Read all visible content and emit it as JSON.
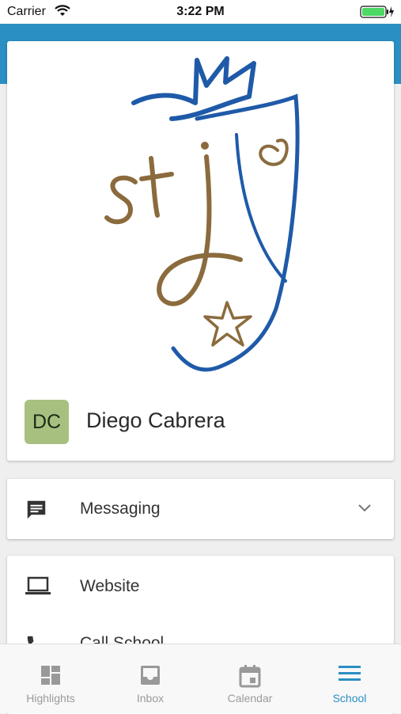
{
  "status_bar": {
    "carrier": "Carrier",
    "time": "3:22 PM"
  },
  "profile": {
    "logo_text": "stj",
    "avatar_initials": "DC",
    "name": "Diego Cabrera",
    "avatar_color": "#a7c080"
  },
  "menu": {
    "messaging_label": "Messaging",
    "website_label": "Website",
    "call_label": "Call School"
  },
  "tabs": [
    {
      "label": "Highlights",
      "icon": "dashboard-icon"
    },
    {
      "label": "Inbox",
      "icon": "inbox-icon"
    },
    {
      "label": "Calendar",
      "icon": "calendar-icon"
    },
    {
      "label": "School",
      "icon": "menu-icon"
    }
  ],
  "colors": {
    "accent": "#2a8fc3",
    "logo_blue": "#1f5aa8",
    "logo_brown": "#8b6b3d"
  },
  "active_tab": "School"
}
